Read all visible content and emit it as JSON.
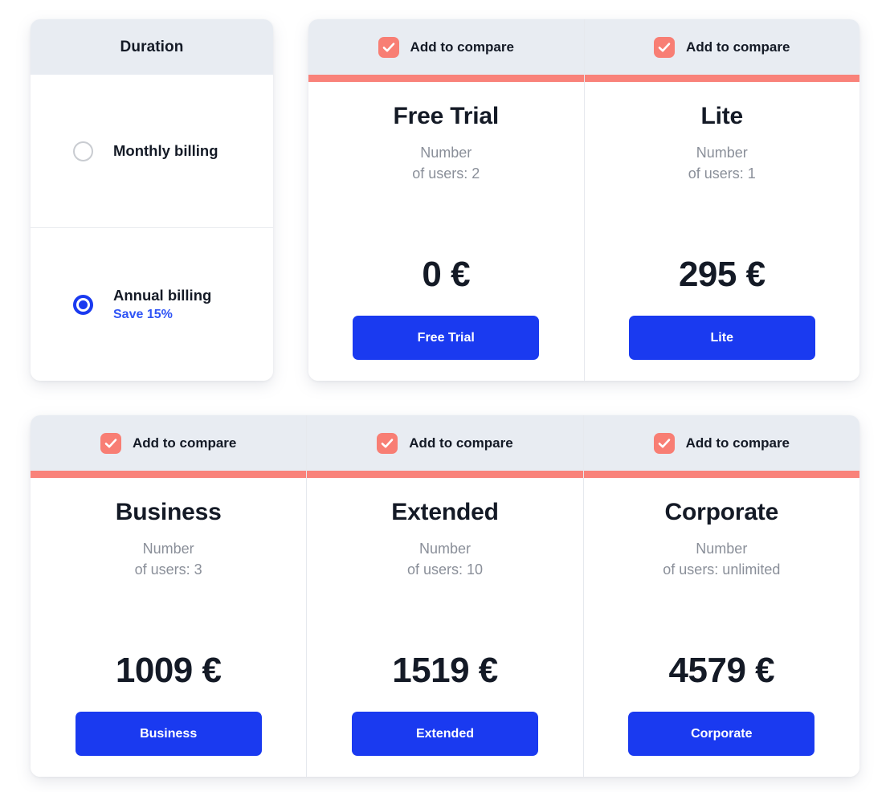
{
  "duration": {
    "title": "Duration",
    "options": [
      {
        "label": "Monthly billing",
        "sub": "",
        "selected": false
      },
      {
        "label": "Annual billing",
        "sub": "Save 15%",
        "selected": true
      }
    ]
  },
  "compare": {
    "label": "Add to compare",
    "checked": true,
    "icon": "check-icon"
  },
  "colors": {
    "accent_bar": "#f9827a",
    "checkbox": "#f87e74",
    "button": "#1a3af0",
    "header_bg": "#e8ecf2",
    "link": "#2f54f5",
    "muted_text": "#8a8f99"
  },
  "plans_row1": [
    {
      "name": "Free Trial",
      "users": "Number\nof users: 2",
      "price": "0 €",
      "button": "Free Trial",
      "compare_label": "Add to compare"
    },
    {
      "name": "Lite",
      "users": "Number\nof users: 1",
      "price": "295 €",
      "button": "Lite",
      "compare_label": "Add to compare"
    }
  ],
  "plans_row2": [
    {
      "name": "Business",
      "users": "Number\nof users: 3",
      "price": "1009 €",
      "button": "Business",
      "compare_label": "Add to compare"
    },
    {
      "name": "Extended",
      "users": "Number\nof users: 10",
      "price": "1519 €",
      "button": "Extended",
      "compare_label": "Add to compare"
    },
    {
      "name": "Corporate",
      "users": "Number\nof users: unlimited",
      "price": "4579 €",
      "button": "Corporate",
      "compare_label": "Add to compare"
    }
  ]
}
